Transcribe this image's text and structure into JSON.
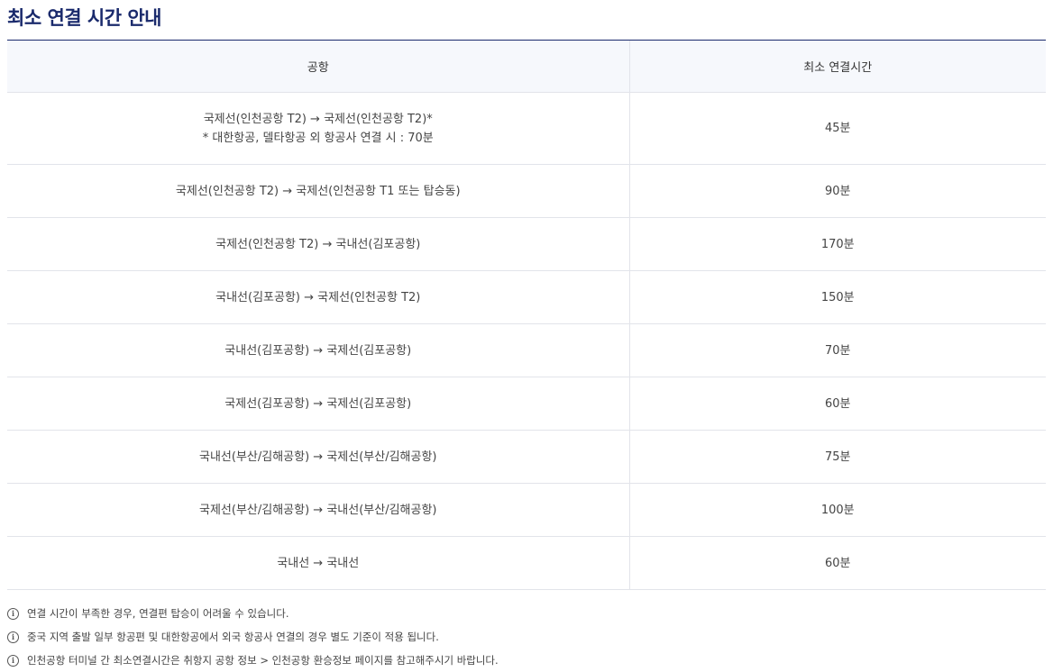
{
  "page_title": "최소 연결 시간 안내",
  "table": {
    "headers": [
      "공항",
      "최소 연결시간"
    ],
    "rows": [
      {
        "route": "국제선(인천공항 T2) → 국제선(인천공항 T2)*",
        "route_note": "* 대한항공, 델타항공 외 항공사 연결 시 : 70분",
        "time": "45분"
      },
      {
        "route": "국제선(인천공항 T2) → 국제선(인천공항 T1 또는 탑승동)",
        "time": "90분"
      },
      {
        "route": "국제선(인천공항 T2) → 국내선(김포공항)",
        "time": "170분"
      },
      {
        "route": "국내선(김포공항) → 국제선(인천공항 T2)",
        "time": "150분"
      },
      {
        "route": "국내선(김포공항) → 국제선(김포공항)",
        "time": "70분"
      },
      {
        "route": "국제선(김포공항) → 국제선(김포공항)",
        "time": "60분"
      },
      {
        "route": "국내선(부산/김해공항) → 국제선(부산/김해공항)",
        "time": "75분"
      },
      {
        "route": "국제선(부산/김해공항) → 국내선(부산/김해공항)",
        "time": "100분"
      },
      {
        "route": "국내선 → 국내선",
        "time": "60분"
      }
    ]
  },
  "notes": [
    "연결 시간이 부족한 경우, 연결편 탑승이 어려울 수 있습니다.",
    "중국 지역 출발 일부 항공편 및 대한항공에서 외국 항공사 연결의 경우 별도 기준이 적용 됩니다.",
    "인천공항 터미널 간 최소연결시간은 취항지 공항 정보 > 인천공항 환승정보 페이지를 참고해주시기 바랍니다."
  ],
  "icons": {
    "note": "info-icon"
  },
  "colors": {
    "title": "#1a2a6c",
    "header_bg": "#f6f8fc",
    "border": "#e2e4ea"
  }
}
